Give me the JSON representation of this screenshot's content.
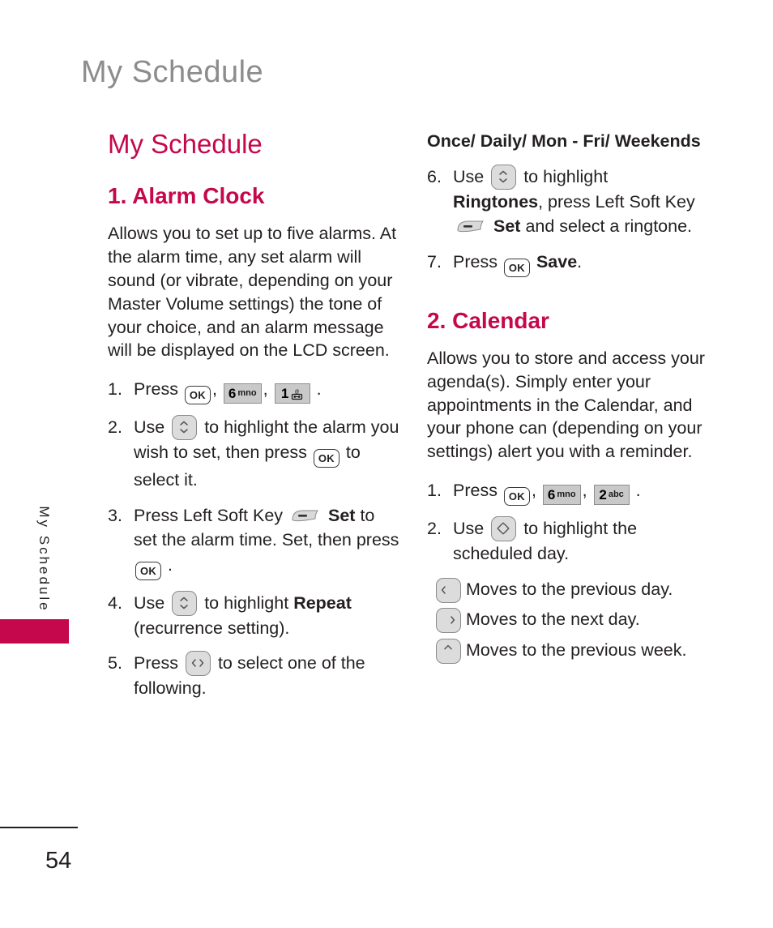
{
  "colors": {
    "accent_pink": "#C5084B",
    "running_head_gray": "#8C8C8C",
    "body_text": "#231F20",
    "key_gray": "#C9C9C9",
    "nav_key_gray": "#DCDCDC"
  },
  "running_head": "My Schedule",
  "side_tab": {
    "label": "My Schedule"
  },
  "page_number": "54",
  "left_column": {
    "section_title": "My Schedule",
    "subsection_title": "1. Alarm Clock",
    "intro": "Allows you to set up to five alarms. At the alarm time, any set alarm will sound (or vibrate, depending on your Master Volume settings) the tone of your choice, and an alarm message will be displayed on the LCD screen.",
    "steps": [
      {
        "num": "1.",
        "pre": "Press",
        "keys": [
          "ok-key",
          "6-mno-key",
          "1-voicemail-key"
        ],
        "post": ".",
        "key_labels": {
          "ok": "OK",
          "six_digit": "6",
          "six_sup": "mno",
          "one_digit": "1"
        }
      },
      {
        "num": "2.",
        "pre": "Use",
        "nav": "up-down-nav-key",
        "mid": "to highlight the alarm you wish to set, then press",
        "key2": "ok-key",
        "post": "to select it."
      },
      {
        "num": "3.",
        "pre": "Press Left Soft Key",
        "soft": "left-soft-key",
        "bold": "Set",
        "mid": "to set the alarm time. Set, then press",
        "key2": "ok-key",
        "post": "."
      },
      {
        "num": "4.",
        "pre": "Use",
        "nav": "up-down-nav-key",
        "mid": "to highlight",
        "bold": "Repeat",
        "post": "(recurrence setting)."
      },
      {
        "num": "5.",
        "pre": "Press",
        "nav": "left-right-nav-key",
        "post": "to select one of the following."
      }
    ]
  },
  "right_column": {
    "options_line": "Once/ Daily/ Mon - Fri/ Weekends",
    "steps": [
      {
        "num": "6.",
        "pre": "Use",
        "nav": "up-down-nav-key",
        "mid": "to highlight",
        "bold": "Ringtones",
        "mid2": ", press Left Soft Key",
        "soft": "left-soft-key",
        "bold2": "Set",
        "post": "and select a ringtone."
      },
      {
        "num": "7.",
        "pre": "Press",
        "key": "ok-key",
        "bold": "Save",
        "post": "."
      }
    ],
    "subsection_title": "2. Calendar",
    "intro": "Allows you to store and access your agenda(s). Simply enter your appointments in the Calendar, and your phone can (depending on your settings) alert you with a reminder.",
    "steps2": [
      {
        "num": "1.",
        "pre": "Press",
        "keys": [
          "ok-key",
          "6-mno-key",
          "2-abc-key"
        ],
        "post": ".",
        "key_labels": {
          "ok": "OK",
          "six_digit": "6",
          "six_sup": "mno",
          "two_digit": "2",
          "two_sup": "abc"
        }
      },
      {
        "num": "2.",
        "pre": "Use",
        "nav": "four-way-nav-key",
        "post": "to highlight the scheduled day."
      }
    ],
    "key_list": [
      {
        "icon": "left-arrow-nav-key",
        "text": "Moves to the previous day."
      },
      {
        "icon": "right-arrow-nav-key",
        "text": "Moves to the next day."
      },
      {
        "icon": "up-arrow-nav-key",
        "text": "Moves to the previous week."
      }
    ]
  }
}
